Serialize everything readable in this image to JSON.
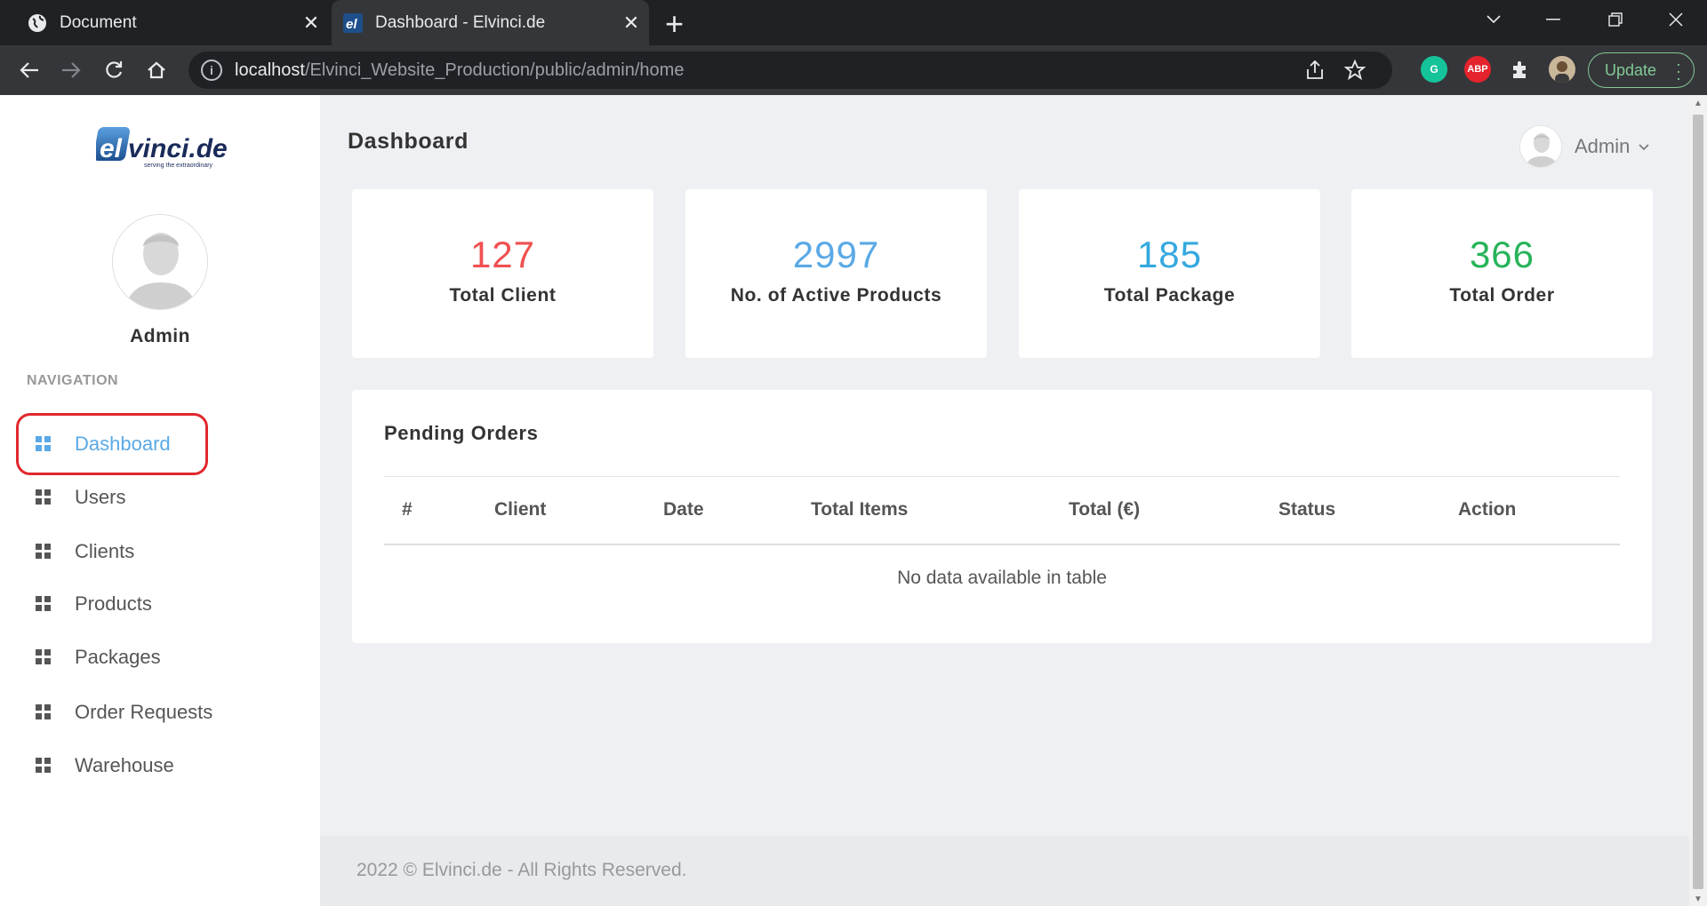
{
  "browser": {
    "tabs": [
      {
        "title": "Document",
        "close": "✕"
      },
      {
        "title": "Dashboard - Elvinci.de",
        "close": "✕"
      }
    ],
    "new_tab": "+",
    "url_host": "localhost",
    "url_path": "/Elvinci_Website_Production/public/admin/home",
    "update_label": "Update",
    "extensions": [
      "grammarly-icon",
      "adblock-plus-icon",
      "puzzle-icon",
      "profile-avatar"
    ],
    "abp_label": "ABP",
    "grammarly_label": "G"
  },
  "sidebar": {
    "logo_text": "elvinci.de",
    "logo_tagline": "serving the extraordinary",
    "user_name": "Admin",
    "nav_heading": "NAVIGATION",
    "items": [
      {
        "label": "Dashboard",
        "active": true
      },
      {
        "label": "Users"
      },
      {
        "label": "Clients"
      },
      {
        "label": "Products"
      },
      {
        "label": "Packages"
      },
      {
        "label": "Order Requests"
      },
      {
        "label": "Warehouse"
      }
    ]
  },
  "header": {
    "title": "Dashboard",
    "user_name": "Admin"
  },
  "stats": [
    {
      "value": "127",
      "label": "Total Client",
      "color": "#f05050"
    },
    {
      "value": "2997",
      "label": "No. of Active Products",
      "color": "#5aa9e6"
    },
    {
      "value": "185",
      "label": "Total Package",
      "color": "#35a8e0"
    },
    {
      "value": "366",
      "label": "Total Order",
      "color": "#27b35a"
    }
  ],
  "pending_orders": {
    "title": "Pending Orders",
    "columns": [
      "#",
      "Client",
      "Date",
      "Total Items",
      "Total (€)",
      "Status",
      "Action"
    ],
    "empty_text": "No data available in table"
  },
  "footer": {
    "text": "2022 © Elvinci.de - All Rights Reserved."
  },
  "colors": {
    "accent": "#5aa9e6",
    "highlight_ring": "#e0282d"
  }
}
